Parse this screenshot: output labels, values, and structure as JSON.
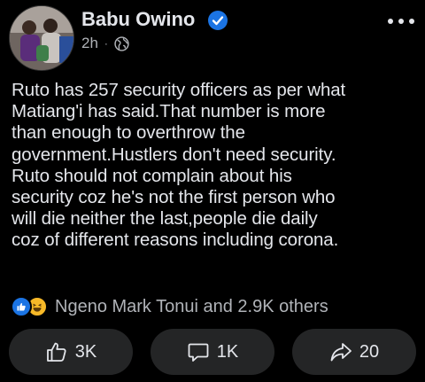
{
  "post": {
    "author": "Babu Owino",
    "verified": true,
    "timestamp": "2h",
    "separator": "·",
    "privacy_icon": "globe-icon",
    "more_icon": "more-dots-icon",
    "text": "Ruto has 257 security officers as per what\nMatiang'i has said.That number is more\nthan enough to overthrow the\ngovernment.Hustlers don't need security.\nRuto should not complain about his\nsecurity coz he's not the first person who\nwill die neither the last,people die daily\ncoz of different reasons including corona."
  },
  "reactions": {
    "icons": [
      "like-icon",
      "haha-icon"
    ],
    "summary": "Ngeno Mark Tonui and 2.9K others"
  },
  "actions": {
    "like": {
      "icon": "thumbs-up-icon",
      "count": "3K"
    },
    "comment": {
      "icon": "comment-bubble-icon",
      "count": "1K"
    },
    "share": {
      "icon": "share-arrow-icon",
      "count": "20"
    }
  },
  "colors": {
    "background": "#000000",
    "text_primary": "#e4e6eb",
    "text_secondary": "#b0b3b8",
    "verified_blue": "#1b74e4",
    "button_bg": "#242526",
    "haha_yellow": "#f7b928"
  }
}
